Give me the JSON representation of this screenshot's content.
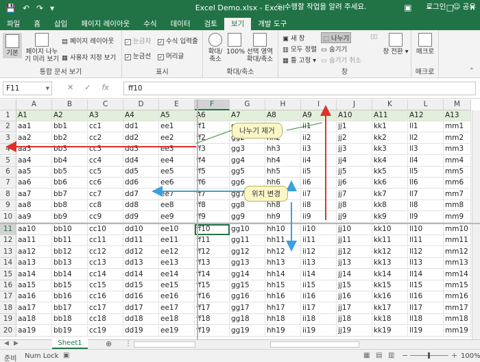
{
  "app": {
    "title": "Excel Demo.xlsx - Excel"
  },
  "tabs": [
    "파일",
    "홈",
    "삽입",
    "페이지 레이아웃",
    "수식",
    "데이터",
    "검토",
    "보기",
    "개발 도구"
  ],
  "active_tab": "보기",
  "tellme": "수행할 작업을 알려 주세요.",
  "account": {
    "login": "로그인",
    "share": "공유"
  },
  "ribbon": {
    "groups": {
      "views": "통합 문서 보기",
      "show": "표시",
      "zoom": "확대/축소",
      "window": "창",
      "macro": "매크로"
    },
    "views": {
      "normal": "기본",
      "pagebreak": "페이지 나누기 미리 보기",
      "layout": "페이지 레이아웃",
      "custom": "사용자 지정 보기"
    },
    "show": {
      "ruler": "눈금자",
      "formula_bar": "수식 입력줄",
      "gridlines": "눈금선",
      "headings": "머리글"
    },
    "zoom": {
      "zoom": "확대/축소",
      "z100": "100%",
      "selection": "선택 영역 확대/축소"
    },
    "window": {
      "new": "새 창",
      "arrange": "모두 정렬",
      "freeze": "틀 고정",
      "split": "나누기",
      "hide": "숨기기",
      "unhide": "숨기기 취소",
      "switch": "창 전환"
    },
    "macro": {
      "macros": "매크로"
    }
  },
  "formula": {
    "namebox": "F11",
    "content": "ff10"
  },
  "columns": [
    "A",
    "B",
    "C",
    "D",
    "E",
    "F",
    "G",
    "H",
    "I",
    "J",
    "K",
    "L",
    "M"
  ],
  "rows": [
    "1",
    "2",
    "3",
    "4",
    "5",
    "6",
    "7",
    "8",
    "9",
    "10",
    "11",
    "12",
    "13",
    "14",
    "15",
    "16",
    "17",
    "18",
    "19",
    "20"
  ],
  "cells": [
    [
      "A1",
      "A2",
      "A3",
      "A4",
      "A5",
      "A6",
      "A7",
      "A8",
      "A9",
      "A10",
      "A11",
      "A12",
      "A13"
    ],
    [
      "aa1",
      "bb1",
      "cc1",
      "dd1",
      "ee1",
      "ff1",
      "gg1",
      "hh1",
      "ii1",
      "jj1",
      "kk1",
      "ll1",
      "mm1"
    ],
    [
      "aa2",
      "bb2",
      "cc2",
      "dd2",
      "ee2",
      "ff2",
      "gg2",
      "hh2",
      "ii2",
      "jj2",
      "kk2",
      "ll2",
      "mm2"
    ],
    [
      "aa3",
      "bb3",
      "cc3",
      "dd3",
      "ee3",
      "ff3",
      "gg3",
      "hh3",
      "ii3",
      "jj3",
      "kk3",
      "ll3",
      "mm3"
    ],
    [
      "aa4",
      "bb4",
      "cc4",
      "dd4",
      "ee4",
      "ff4",
      "gg4",
      "hh4",
      "ii4",
      "jj4",
      "kk4",
      "ll4",
      "mm4"
    ],
    [
      "aa5",
      "bb5",
      "cc5",
      "dd5",
      "ee5",
      "ff5",
      "gg5",
      "hh5",
      "ii5",
      "jj5",
      "kk5",
      "ll5",
      "mm5"
    ],
    [
      "aa6",
      "bb6",
      "cc6",
      "dd6",
      "ee6",
      "ff6",
      "gg6",
      "hh6",
      "ii6",
      "jj6",
      "kk6",
      "ll6",
      "mm6"
    ],
    [
      "aa7",
      "bb7",
      "cc7",
      "dd7",
      "ee7",
      "ff7",
      "gg7",
      "hh7",
      "ii7",
      "jj7",
      "kk7",
      "ll7",
      "mm7"
    ],
    [
      "aa8",
      "bb8",
      "cc8",
      "dd8",
      "ee8",
      "ff8",
      "gg8",
      "hh8",
      "ii8",
      "jj8",
      "kk8",
      "ll8",
      "mm8"
    ],
    [
      "aa9",
      "bb9",
      "cc9",
      "dd9",
      "ee9",
      "ff9",
      "gg9",
      "hh9",
      "ii9",
      "jj9",
      "kk9",
      "ll9",
      "mm9"
    ],
    [
      "aa10",
      "bb10",
      "cc10",
      "dd10",
      "ee10",
      "ff10",
      "gg10",
      "hh10",
      "ii10",
      "jj10",
      "kk10",
      "ll10",
      "mm10"
    ],
    [
      "aa11",
      "bb11",
      "cc11",
      "dd11",
      "ee11",
      "ff11",
      "gg11",
      "hh11",
      "ii11",
      "jj11",
      "kk11",
      "ll11",
      "mm11"
    ],
    [
      "aa12",
      "bb12",
      "cc12",
      "dd12",
      "ee12",
      "ff12",
      "gg12",
      "hh12",
      "ii12",
      "jj12",
      "kk12",
      "ll12",
      "mm12"
    ],
    [
      "aa13",
      "bb13",
      "cc13",
      "dd13",
      "ee13",
      "ff13",
      "gg13",
      "hh13",
      "ii13",
      "jj13",
      "kk13",
      "ll13",
      "mm13"
    ],
    [
      "aa14",
      "bb14",
      "cc14",
      "dd14",
      "ee14",
      "ff14",
      "gg14",
      "hh14",
      "ii14",
      "jj14",
      "kk14",
      "ll14",
      "mm14"
    ],
    [
      "aa15",
      "bb15",
      "cc15",
      "dd15",
      "ee15",
      "ff15",
      "gg15",
      "hh15",
      "ii15",
      "jj15",
      "kk15",
      "ll15",
      "mm15"
    ],
    [
      "aa16",
      "bb16",
      "cc16",
      "dd16",
      "ee16",
      "ff16",
      "gg16",
      "hh16",
      "ii16",
      "jj16",
      "kk16",
      "ll16",
      "mm16"
    ],
    [
      "aa17",
      "bb17",
      "cc17",
      "dd17",
      "ee17",
      "ff17",
      "gg17",
      "hh17",
      "ii17",
      "jj17",
      "kk17",
      "ll17",
      "mm17"
    ],
    [
      "aa18",
      "bb18",
      "cc18",
      "dd18",
      "ee18",
      "ff18",
      "gg18",
      "hh18",
      "ii18",
      "jj18",
      "kk18",
      "ll18",
      "mm18"
    ],
    [
      "aa19",
      "bb19",
      "cc19",
      "dd19",
      "ee19",
      "ff19",
      "gg19",
      "hh19",
      "ii19",
      "jj19",
      "kk19",
      "ll19",
      "mm19"
    ]
  ],
  "annotations": {
    "remove_split": "나누기 제거",
    "move_split": "위치 변경"
  },
  "sheet": {
    "name": "Sheet1"
  },
  "status": {
    "ready": "준비",
    "numlock": "Num Lock",
    "zoom": "100%"
  },
  "colors": {
    "excel_green": "#217346",
    "arrow_red": "#e0302c",
    "arrow_blue": "#3aa0de",
    "annotation_bg": "#fbf6c8"
  }
}
